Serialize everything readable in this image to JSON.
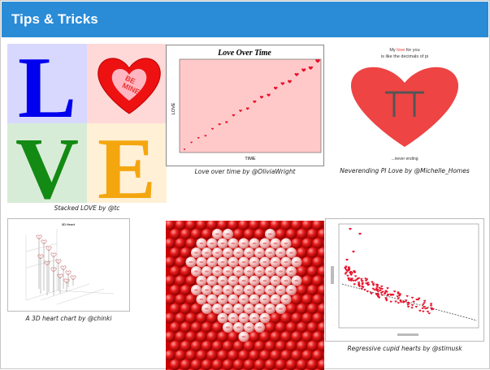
{
  "header": {
    "title": "Tips & Tricks"
  },
  "gallery": [
    {
      "id": "stacked-love",
      "caption": "Stacked LOVE by @tc",
      "letters": [
        "L",
        "V",
        "E"
      ],
      "heart_text_1": "BE",
      "heart_text_2": "MINE"
    },
    {
      "id": "love-over-time",
      "caption": "Love over time by @OliviaWright",
      "title": "Love Over Time",
      "ylabel": "LOVE",
      "xlabel": "TIME"
    },
    {
      "id": "pi-love",
      "caption": "Neverending PI Love by @Michelle_Homes",
      "line1_a": "My ",
      "line1_b": "love",
      "line1_c": " for you",
      "line2": "is like the decimals of pi",
      "footer": "...never ending"
    },
    {
      "id": "heart-3d",
      "caption": "A 3D heart chart by @chinki",
      "title": "3D Heart"
    },
    {
      "id": "heart-balls",
      "caption": ""
    },
    {
      "id": "cupid-hearts",
      "caption": "Regressive cupid hearts by @stimusk"
    }
  ],
  "colors": {
    "header_bg": "#2a8bd7",
    "love_blue": "#0000ee",
    "love_red": "#ee1111",
    "love_green": "#138a13",
    "love_orange": "#f4a60f"
  }
}
